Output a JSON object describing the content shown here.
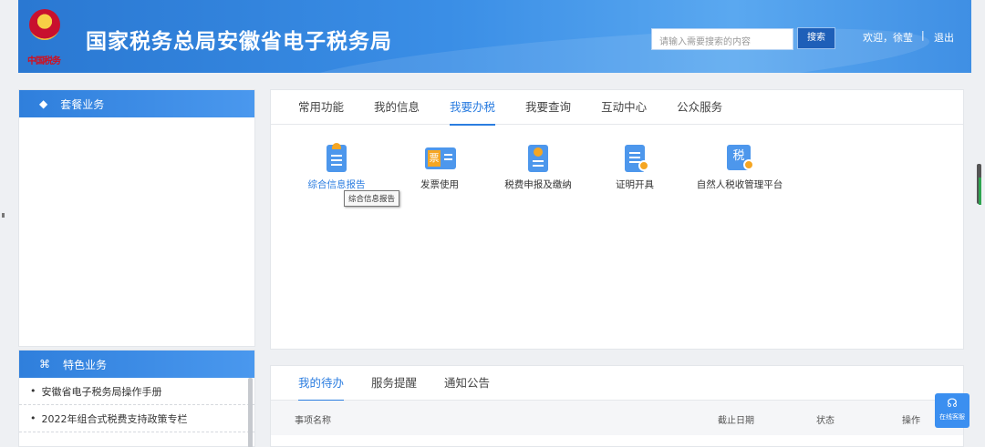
{
  "header": {
    "emblem_sub": "中国税务",
    "title": "国家税务总局安徽省电子税务局",
    "search_placeholder": "请输入需要搜索的内容",
    "search_button": "搜索",
    "welcome": "欢迎，徐莹",
    "separator": "|",
    "logout": "退出"
  },
  "left": {
    "package_title": "套餐业务",
    "featured_title": "特色业务",
    "featured_items": [
      "安徽省电子税务局操作手册",
      "2022年组合式税费支持政策专栏"
    ]
  },
  "main": {
    "tabs": [
      "常用功能",
      "我的信息",
      "我要办税",
      "我要查询",
      "互动中心",
      "公众服务"
    ],
    "active_tab": "我要办税",
    "functions": [
      {
        "label": "综合信息报告",
        "icon": "report-icon",
        "color": "#2b7de0"
      },
      {
        "label": "发票使用",
        "icon": "invoice-icon"
      },
      {
        "label": "税费申报及缴纳",
        "icon": "tax-declare-icon"
      },
      {
        "label": "证明开具",
        "icon": "certificate-icon"
      },
      {
        "label": "自然人税收管理平台",
        "icon": "personal-tax-icon"
      }
    ],
    "tooltip": "综合信息报告"
  },
  "bottom": {
    "tabs": [
      "我的待办",
      "服务提醒",
      "通知公告"
    ],
    "columns": [
      "事项名称",
      "截止日期",
      "状态",
      "操作"
    ]
  },
  "chat": {
    "label": "在线客服"
  },
  "colors": {
    "accent": "#2b7de0",
    "header_start": "#2a78d2",
    "header_end": "#5aa8f0"
  }
}
